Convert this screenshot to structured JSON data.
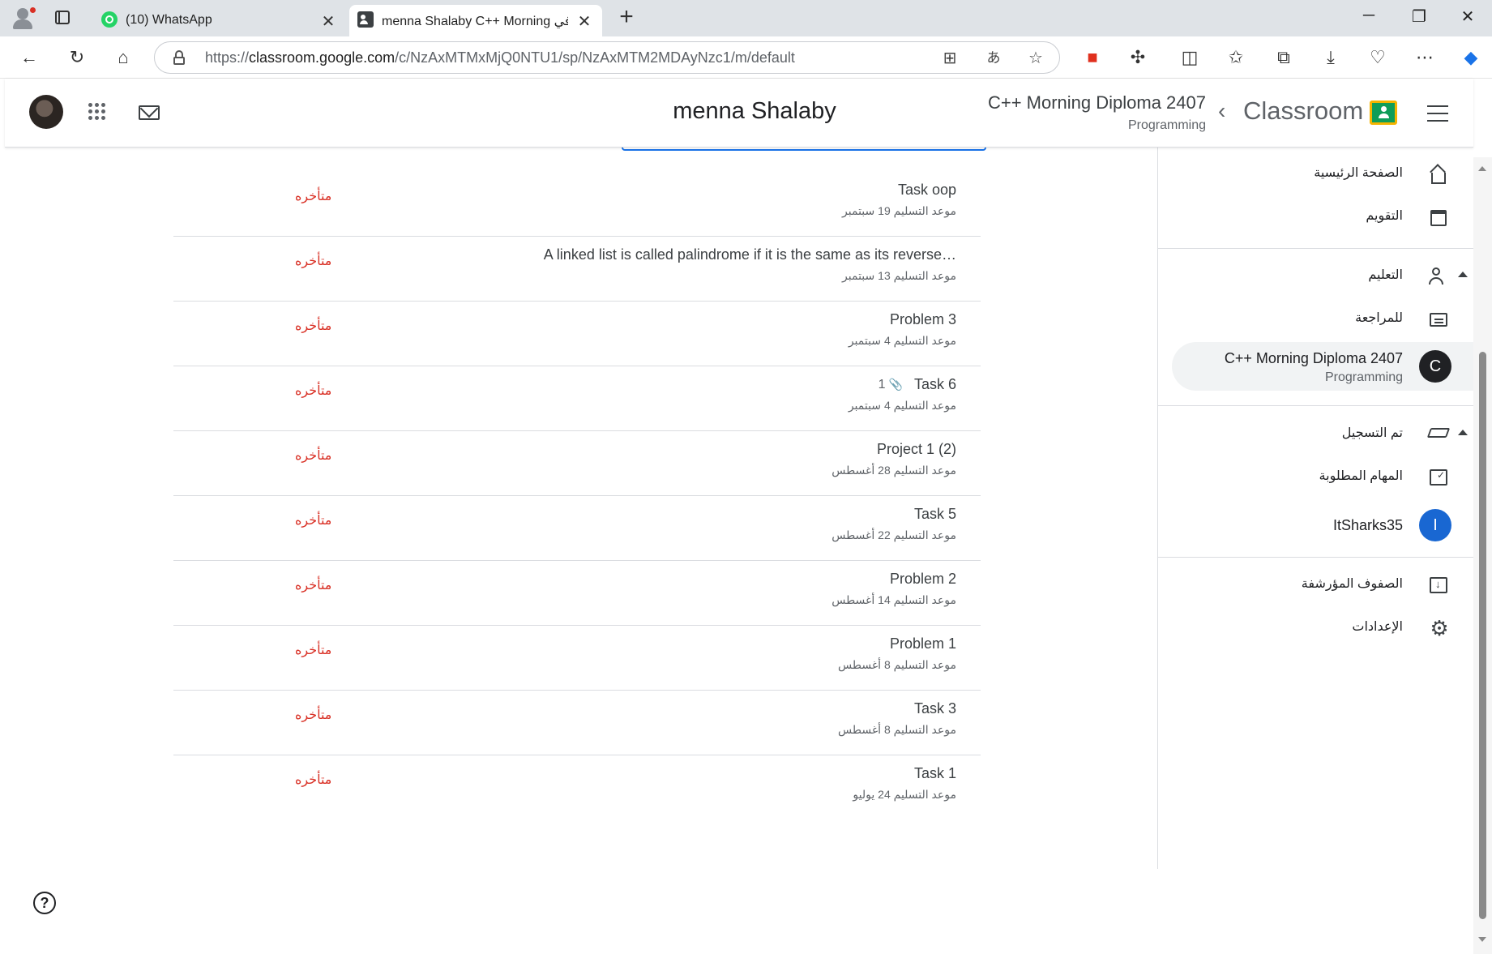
{
  "browser": {
    "tabs": [
      {
        "title": "(10) WhatsApp",
        "icon": "whatsapp-icon",
        "active": false
      },
      {
        "title": "menna Shalaby C++ Morning في",
        "icon": "classroom-tab-icon",
        "active": true
      }
    ],
    "url_prefix": "https://",
    "url_domain": "classroom.google.com",
    "url_path": "/c/NzAxMTMxMjQ0NTU1/sp/NzAxMTM2MDAyNzc1/m/default",
    "new_tab_glyph": "+",
    "close_glyph": "✕"
  },
  "appbar": {
    "student_name": "menna Shalaby",
    "course_title": "C++ Morning Diploma 2407",
    "course_subtitle": "Programming",
    "brand": "Classroom",
    "back_glyph": "‹"
  },
  "tasks": [
    {
      "name": "Task oop",
      "due": "موعد التسليم 19 سبتمبر",
      "status": "متأخره",
      "attachments": ""
    },
    {
      "name": "A linked list is called palindrome if it is the same as its reverse…",
      "due": "موعد التسليم 13 سبتمبر",
      "status": "متأخره",
      "attachments": ""
    },
    {
      "name": "Problem 3",
      "due": "موعد التسليم 4 سبتمبر",
      "status": "متأخره",
      "attachments": ""
    },
    {
      "name": "Task 6",
      "due": "موعد التسليم 4 سبتمبر",
      "status": "متأخره",
      "attachments": "1"
    },
    {
      "name": "Project 1 (2)",
      "due": "موعد التسليم 28 أغسطس",
      "status": "متأخره",
      "attachments": ""
    },
    {
      "name": "Task 5",
      "due": "موعد التسليم 22 أغسطس",
      "status": "متأخره",
      "attachments": ""
    },
    {
      "name": "Problem 2",
      "due": "موعد التسليم 14 أغسطس",
      "status": "متأخره",
      "attachments": ""
    },
    {
      "name": "Problem 1",
      "due": "موعد التسليم 8 أغسطس",
      "status": "متأخره",
      "attachments": ""
    },
    {
      "name": "Task 3",
      "due": "موعد التسليم 8 أغسطس",
      "status": "متأخره",
      "attachments": ""
    },
    {
      "name": "Task 1",
      "due": "موعد التسليم 24 يوليو",
      "status": "متأخره",
      "attachments": ""
    }
  ],
  "sidebar": {
    "home": "الصفحة الرئيسية",
    "calendar": "التقويم",
    "teaching": "التعليم",
    "to_review": "للمراجعة",
    "teaching_course": {
      "title": "C++ Morning Diploma 2407",
      "subtitle": "Programming",
      "letter": "C",
      "color": "#202124"
    },
    "enrolled": "تم التسجيل",
    "todo": "المهام المطلوبة",
    "enrolled_course": {
      "title": "ItSharks35",
      "letter": "I",
      "color": "#1967d2"
    },
    "archived": "الصفوف المؤرشفة",
    "settings": "الإعدادات"
  },
  "help_glyph": "?",
  "colors": {
    "late": "#d93025",
    "accent": "#1a73e8",
    "classroom_green": "#0f9d58"
  }
}
